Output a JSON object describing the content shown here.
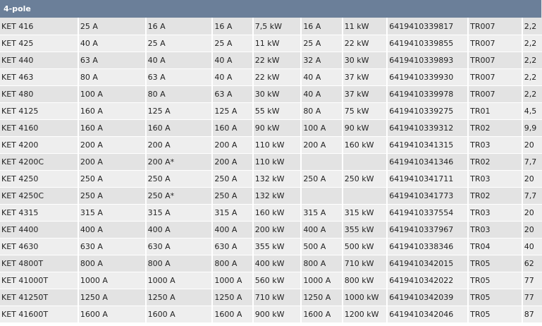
{
  "section_title": "4-pole",
  "rows": [
    [
      "KET 416",
      "25 A",
      "16 A",
      "16 A",
      "7,5 kW",
      "16 A",
      "11 kW",
      "6419410339817",
      "TR007",
      "2,2"
    ],
    [
      "KET 425",
      "40 A",
      "25 A",
      "25 A",
      "11 kW",
      "25 A",
      "22 kW",
      "6419410339855",
      "TR007",
      "2,2"
    ],
    [
      "KET 440",
      "63 A",
      "40 A",
      "40 A",
      "22 kW",
      "32 A",
      "30 kW",
      "6419410339893",
      "TR007",
      "2,2"
    ],
    [
      "KET 463",
      "80 A",
      "63 A",
      "40 A",
      "22 kW",
      "40 A",
      "37 kW",
      "6419410339930",
      "TR007",
      "2,2"
    ],
    [
      "KET 480",
      "100 A",
      "80 A",
      "63 A",
      "30 kW",
      "40 A",
      "37 kW",
      "6419410339978",
      "TR007",
      "2,2"
    ],
    [
      "KET 4125",
      "160 A",
      "125 A",
      "125 A",
      "55 kW",
      "80 A",
      "75 kW",
      "6419410339275",
      "TR01",
      "4,5"
    ],
    [
      "KET 4160",
      "160 A",
      "160 A",
      "160 A",
      "90 kW",
      "100 A",
      "90 kW",
      "6419410339312",
      "TR02",
      "9,9"
    ],
    [
      "KET 4200",
      "200 A",
      "200 A",
      "200 A",
      "110 kW",
      "200 A",
      "160 kW",
      "6419410341315",
      "TR03",
      "20"
    ],
    [
      "KET 4200C",
      "200 A",
      "200 A*",
      "200 A",
      "110 kW",
      "",
      "",
      "6419410341346",
      "TR02",
      "7,7"
    ],
    [
      "KET 4250",
      "250 A",
      "250 A",
      "250 A",
      "132 kW",
      "250 A",
      "250 kW",
      "6419410341711",
      "TR03",
      "20"
    ],
    [
      "KET 4250C",
      "250 A",
      "250 A*",
      "250 A",
      "132 kW",
      "",
      "",
      "6419410341773",
      "TR02",
      "7,7"
    ],
    [
      "KET 4315",
      "315 A",
      "315 A",
      "315 A",
      "160 kW",
      "315 A",
      "315 kW",
      "6419410337554",
      "TR03",
      "20"
    ],
    [
      "KET 4400",
      "400 A",
      "400 A",
      "400 A",
      "200 kW",
      "400 A",
      "355 kW",
      "6419410337967",
      "TR03",
      "20"
    ],
    [
      "KET 4630",
      "630 A",
      "630 A",
      "630 A",
      "355 kW",
      "500 A",
      "500 kW",
      "6419410338346",
      "TR04",
      "40"
    ],
    [
      "KET 4800T",
      "800 A",
      "800 A",
      "800 A",
      "400 kW",
      "800 A",
      "710 kW",
      "6419410342015",
      "TR05",
      "62"
    ],
    [
      "KET 41000T",
      "1000 A",
      "1000 A",
      "1000 A",
      "560 kW",
      "1000 A",
      "800 kW",
      "6419410342022",
      "TR05",
      "77"
    ],
    [
      "KET 41250T",
      "1250 A",
      "1250 A",
      "1250 A",
      "710 kW",
      "1250 A",
      "1000 kW",
      "6419410342039",
      "TR05",
      "77"
    ],
    [
      "KET 41600T",
      "1600 A",
      "1600 A",
      "1600 A",
      "900 kW",
      "1600 A",
      "1200 kW",
      "6419410342046",
      "TR05",
      "87"
    ]
  ]
}
